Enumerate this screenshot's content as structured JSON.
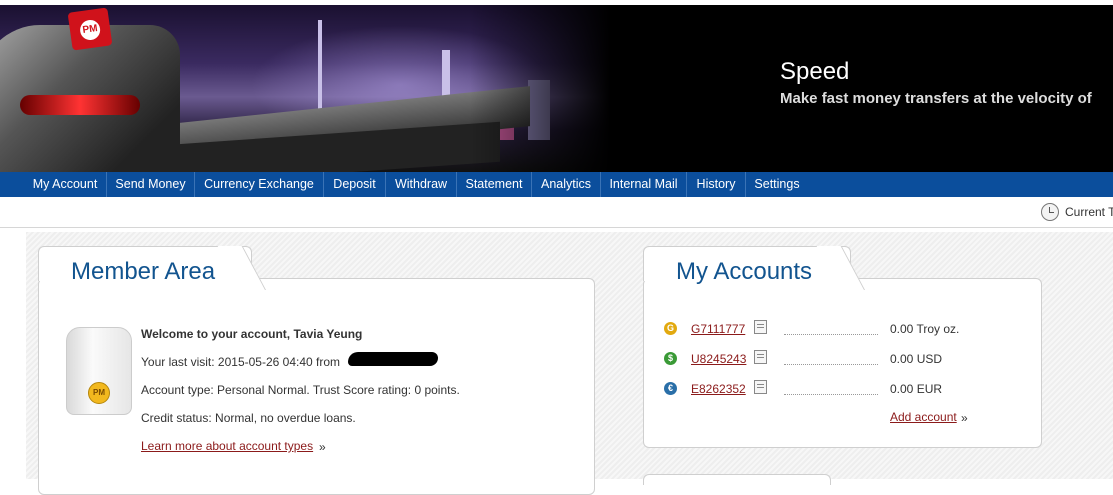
{
  "banner": {
    "title": "Speed",
    "subtitle": "Make fast money transfers at the velocity of",
    "flag_logo": "PM"
  },
  "nav": {
    "items": [
      {
        "label": "My Account"
      },
      {
        "label": "Send Money"
      },
      {
        "label": "Currency Exchange"
      },
      {
        "label": "Deposit"
      },
      {
        "label": "Withdraw"
      },
      {
        "label": "Statement"
      },
      {
        "label": "Analytics"
      },
      {
        "label": "Internal Mail"
      },
      {
        "label": "History"
      },
      {
        "label": "Settings"
      }
    ]
  },
  "timebar": {
    "label": "Current T",
    "icon": "clock-icon"
  },
  "member_area": {
    "title": "Member Area",
    "welcome": "Welcome to your account, Tavia Yeung",
    "last_visit": "Your last visit: 2015-05-26 04:40 from",
    "account_type": "Account type: Personal Normal. Trust Score rating: 0 points.",
    "credit_status": "Credit status: Normal, no overdue loans.",
    "learn_more": "Learn more about account types",
    "raquo": "»",
    "wallet_badge": "PM"
  },
  "my_accounts": {
    "title": "My Accounts",
    "accounts": [
      {
        "id": "G7111777",
        "balance": "0.00 Troy oz.",
        "icon": "gold-coin-icon",
        "color": "#e2a90f",
        "symbol": "G"
      },
      {
        "id": "U8245243",
        "balance": "0.00 USD",
        "icon": "dollar-coin-icon",
        "color": "#3a9a36",
        "symbol": "$"
      },
      {
        "id": "E8262352",
        "balance": "0.00 EUR",
        "icon": "euro-coin-icon",
        "color": "#2a6fa8",
        "symbol": "€"
      }
    ],
    "add_account": "Add account",
    "raquo": "»"
  }
}
